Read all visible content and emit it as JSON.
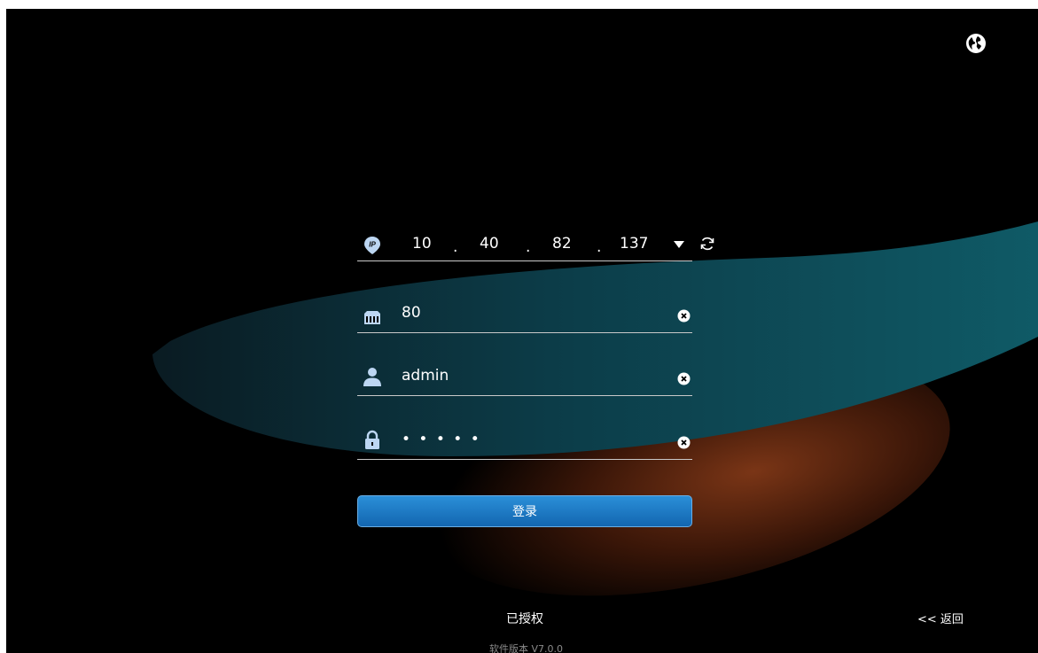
{
  "ip": {
    "seg1": "10",
    "seg2": "40",
    "seg3": "82",
    "seg4": "137",
    "dot": "."
  },
  "port": {
    "value": "80"
  },
  "username": {
    "value": "admin"
  },
  "password": {
    "masked": "• • • • •"
  },
  "login_button": {
    "label": "登录"
  },
  "footer": {
    "license": "已授权",
    "back": "<< 返回",
    "version": "软件版本 V7.0.0"
  },
  "colors": {
    "accent": "#1f7fcf",
    "icon": "#bcd6f2",
    "teal": "#0c4a55",
    "orange": "#7a3516"
  },
  "icons": [
    "globe-icon",
    "ip-pin-icon",
    "dropdown-arrow-icon",
    "refresh-icon",
    "port-icon",
    "user-icon",
    "lock-icon",
    "clear-icon"
  ]
}
